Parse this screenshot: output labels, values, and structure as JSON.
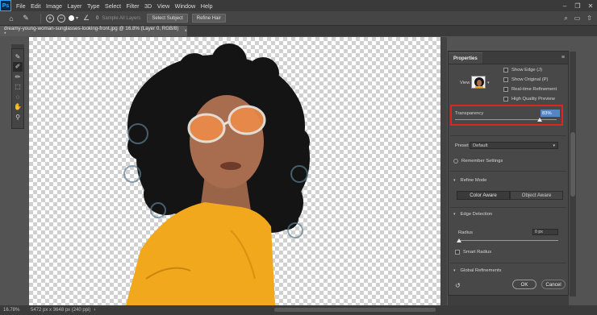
{
  "app": {
    "logo": "Ps"
  },
  "menu": [
    "File",
    "Edit",
    "Image",
    "Layer",
    "Type",
    "Select",
    "Filter",
    "3D",
    "View",
    "Window",
    "Help"
  ],
  "window_controls": [
    "–",
    "❐",
    "✕"
  ],
  "options_bar": {
    "brush_size": "0",
    "sample_all_layers": "Sample All Layers",
    "select_subject": "Select Subject",
    "refine_hair": "Refine Hair"
  },
  "document": {
    "tab_title": "dreamy-young-woman-sunglasses-looking-front.jpg @ 16.8% (Layer 0, RGB/8) *",
    "close": "×"
  },
  "status": {
    "zoom": "16.78%",
    "doc_size": "5472 px x 3648 px (240 ppi)"
  },
  "properties": {
    "tab": "Properties",
    "view_label": "View",
    "show_edge": "Show Edge (J)",
    "show_original": "Show Original (P)",
    "realtime": "Real-time Refinement",
    "high_quality": "High Quality Preview",
    "transparency_label": "Transparency",
    "transparency_value": "83%",
    "transparency_level": 0.83,
    "preset_label": "Preset",
    "preset_value": "Default",
    "remember": "Remember Settings",
    "refine_mode": "Refine Mode",
    "color_aware": "Color Aware",
    "object_aware": "Object Aware",
    "edge_detection": "Edge Detection",
    "radius_label": "Radius",
    "radius_value": "0 px",
    "smart_radius": "Smart Radius",
    "global_refinements": "Global Refinements",
    "ok": "OK",
    "cancel": "Cancel"
  },
  "colors": {
    "highlight_box": "#e02424",
    "sweater": "#f2a81d",
    "lens": "#e98a4a"
  }
}
